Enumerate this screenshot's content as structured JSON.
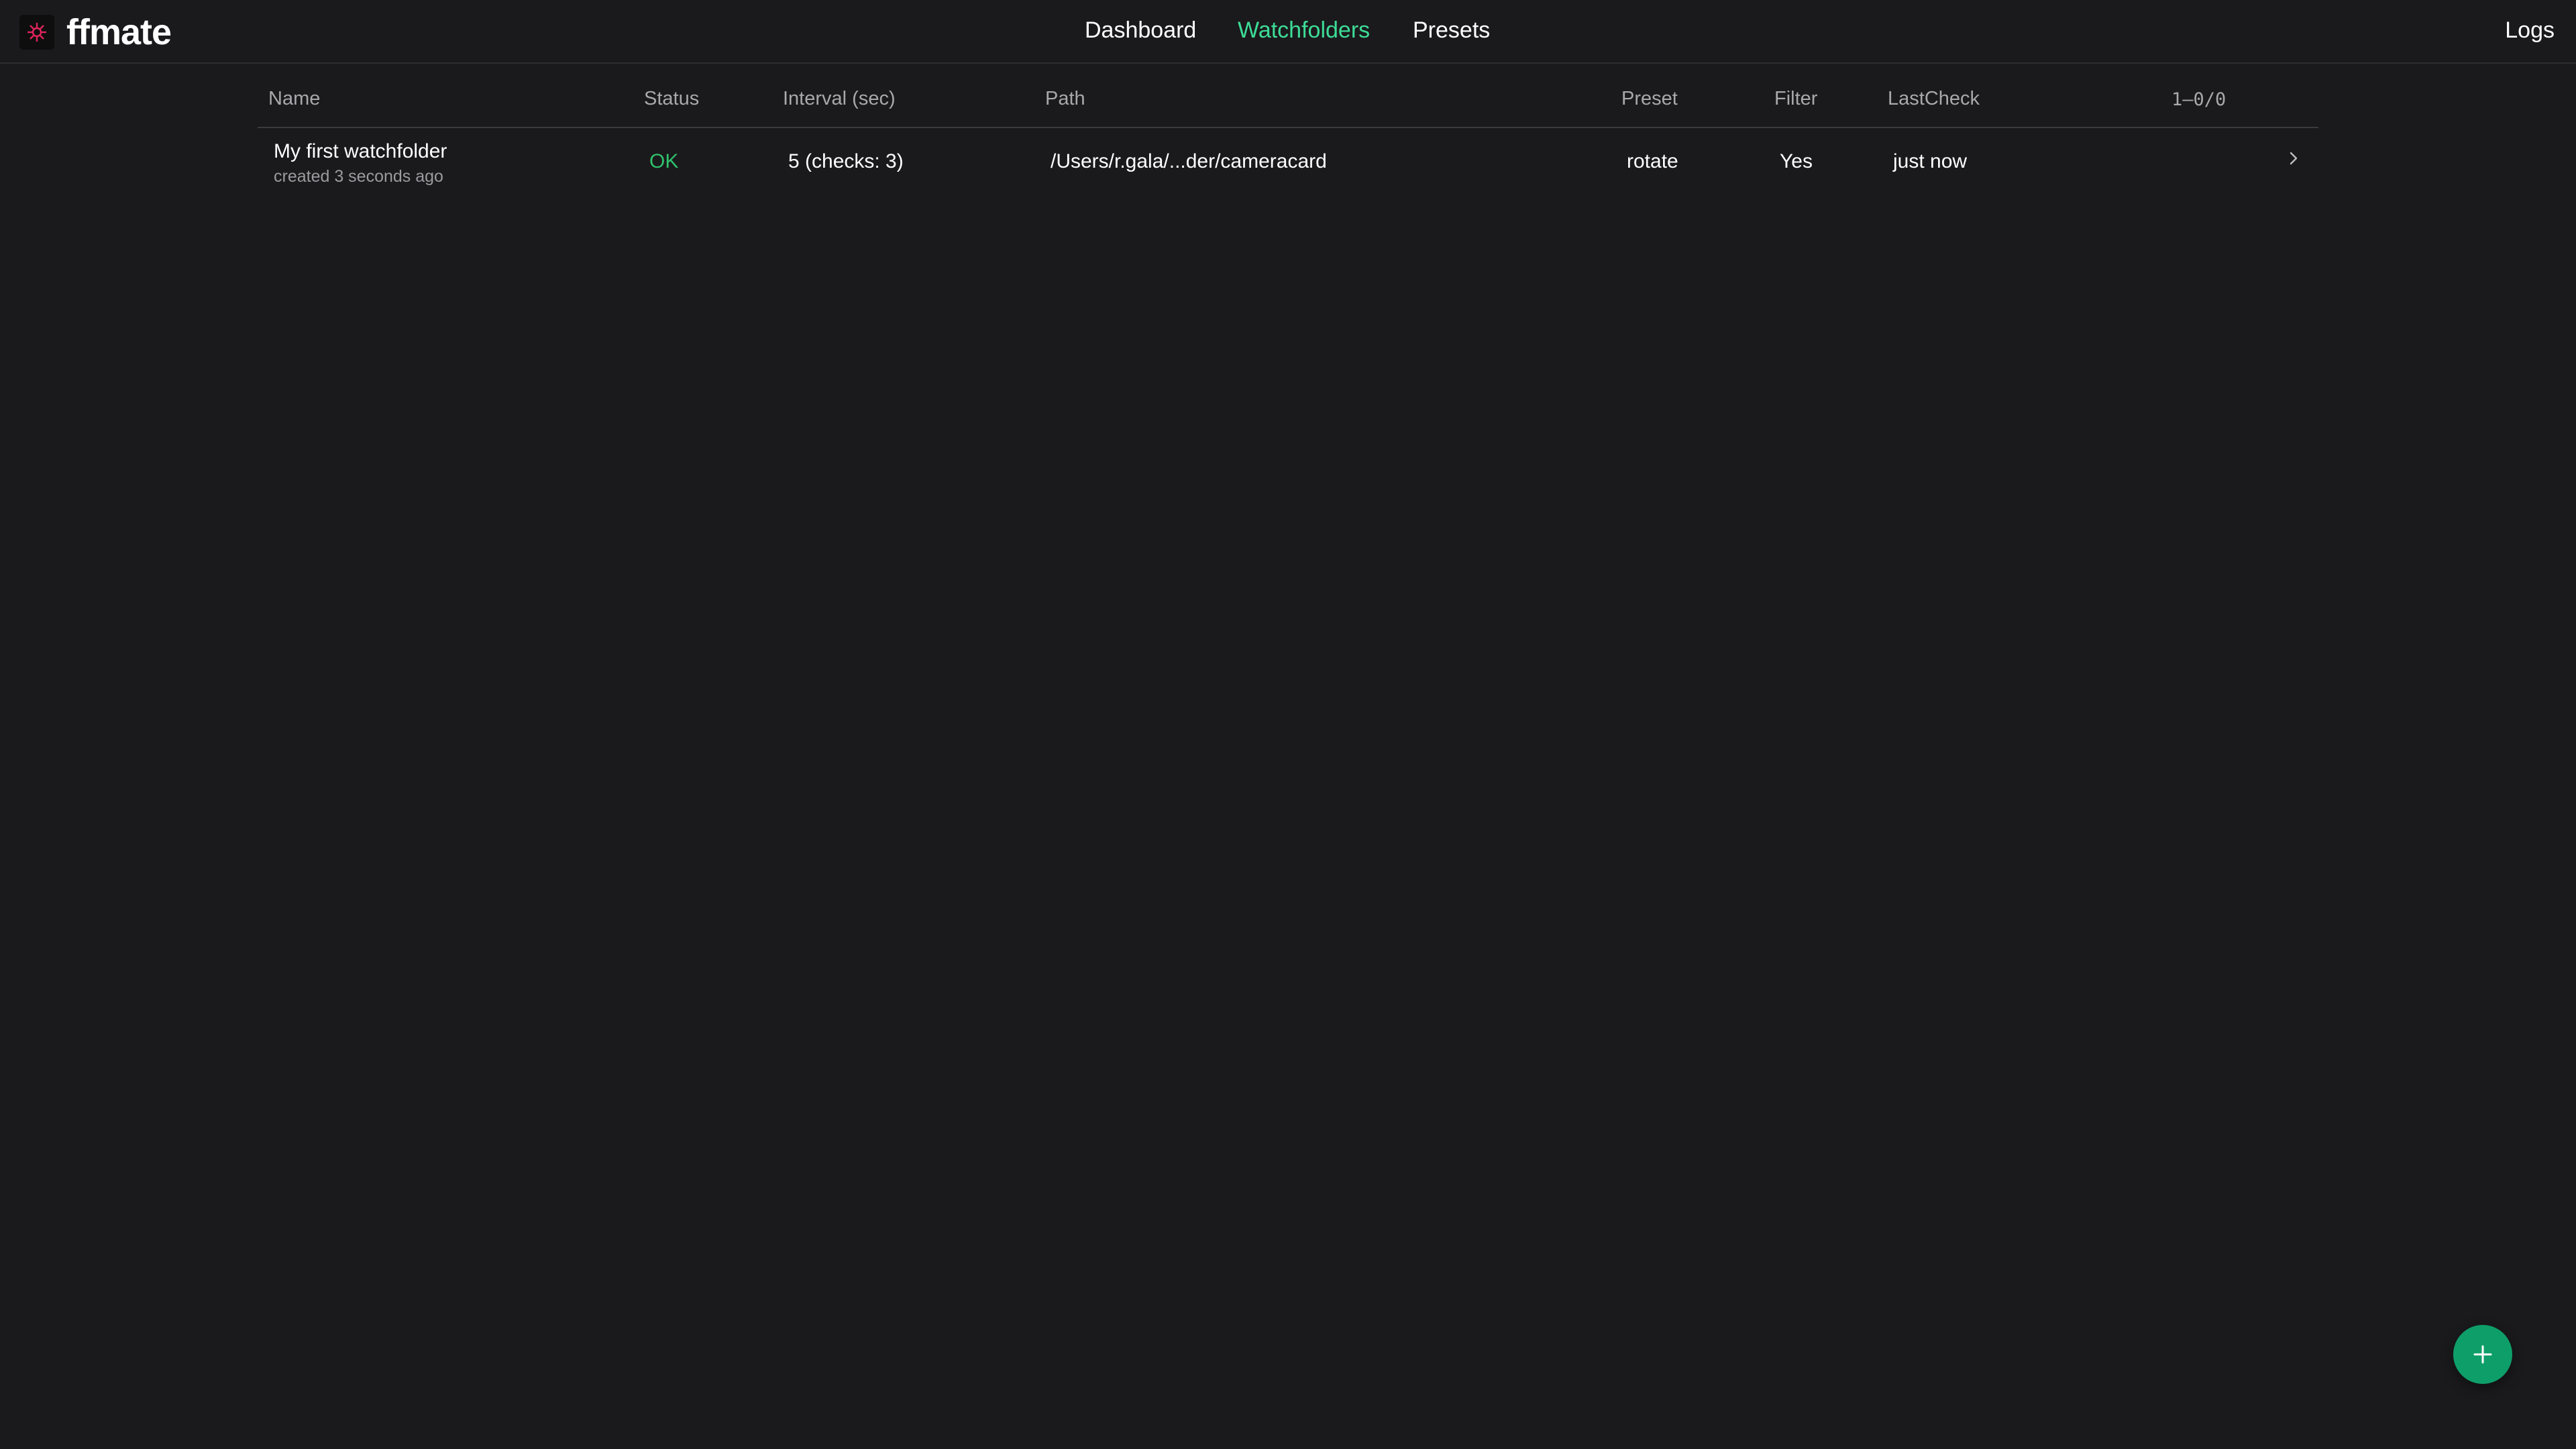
{
  "app": {
    "name": "ffmate"
  },
  "nav": {
    "items": [
      {
        "label": "Dashboard",
        "active": false
      },
      {
        "label": "Watchfolders",
        "active": true
      },
      {
        "label": "Presets",
        "active": false
      }
    ],
    "logs_label": "Logs"
  },
  "table": {
    "columns": [
      "Name",
      "Status",
      "Interval (sec)",
      "Path",
      "Preset",
      "Filter",
      "LastCheck"
    ],
    "pagination": "1–0/0",
    "rows": [
      {
        "name": "My first watchfolder",
        "created": "created 3 seconds ago",
        "status": "OK",
        "interval": "5 (checks: 3)",
        "path": "/Users/r.gala/...der/cameracard",
        "preset": "rotate",
        "filter": "Yes",
        "last_check": "just now"
      }
    ]
  },
  "icons": {
    "logo": "ffmate-logo-icon",
    "row_chevron": "chevron-right-icon",
    "fab": "plus-icon"
  },
  "colors": {
    "background": "#1a1a1c",
    "accent": "#3ddc97",
    "status_ok": "#2fc26b",
    "fab": "#0e9e6a"
  }
}
